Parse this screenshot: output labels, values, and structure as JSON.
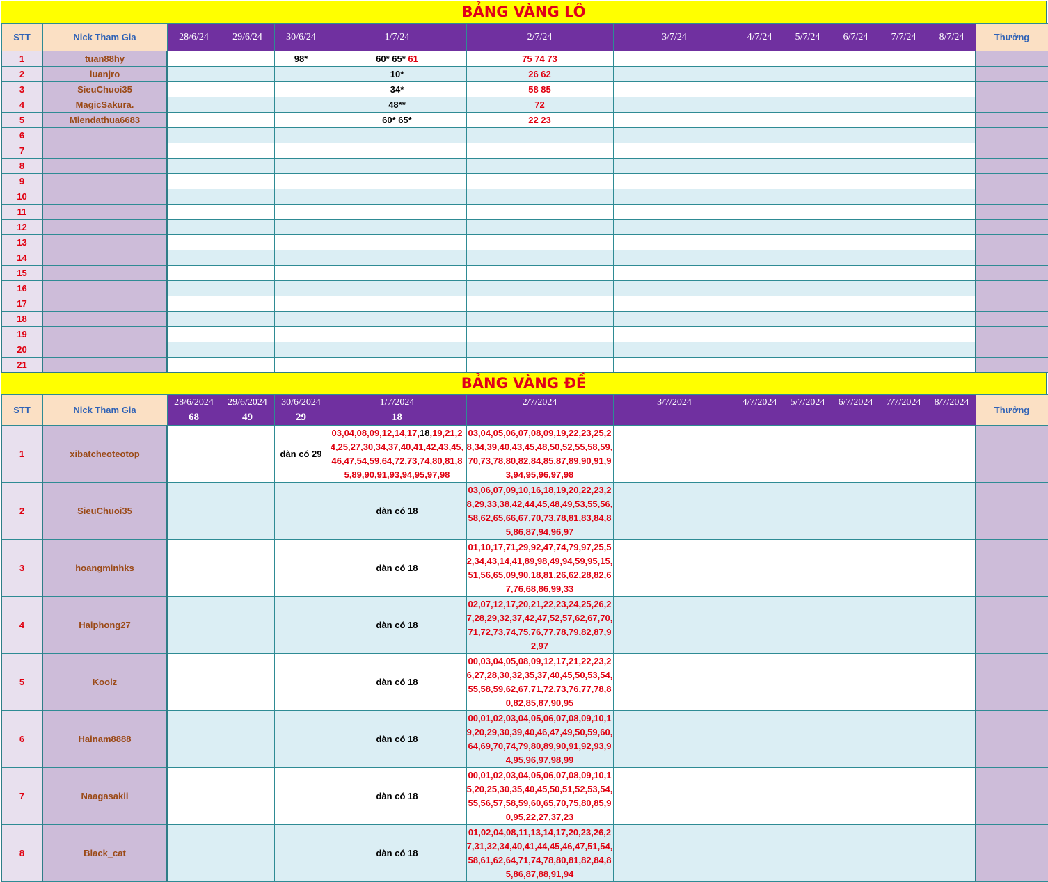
{
  "lo": {
    "title": "BẢNG VÀNG LÔ",
    "headers": {
      "stt": "STT",
      "nick": "Nick Tham Gia",
      "bonus": "Thưởng",
      "dates": [
        "28/6/24",
        "29/6/24",
        "30/6/24",
        "1/7/24",
        "2/7/24",
        "3/7/24",
        "4/7/24",
        "5/7/24",
        "6/7/24",
        "7/7/24",
        "8/7/24"
      ]
    },
    "rows": [
      {
        "stt": "1",
        "nick": "tuan88hy",
        "d30_6": "98*",
        "d1_7": "60*  65*",
        "d1_7_red": " 61",
        "d2_7": "75 74 73"
      },
      {
        "stt": "2",
        "nick": "luanjro",
        "d30_6": "",
        "d1_7": "10*",
        "d1_7_red": "",
        "d2_7": "26 62"
      },
      {
        "stt": "3",
        "nick": "SieuChuoi35",
        "d30_6": "",
        "d1_7": "34*",
        "d1_7_red": "",
        "d2_7": "58 85"
      },
      {
        "stt": "4",
        "nick": "MagicSakura.",
        "d30_6": "",
        "d1_7": "48**",
        "d1_7_red": "",
        "d2_7": "72"
      },
      {
        "stt": "5",
        "nick": "Miendathua6683",
        "d30_6": "",
        "d1_7": "60*  65*",
        "d1_7_red": "",
        "d2_7": "22 23"
      },
      {
        "stt": "6",
        "nick": ""
      },
      {
        "stt": "7",
        "nick": ""
      },
      {
        "stt": "8",
        "nick": ""
      },
      {
        "stt": "9",
        "nick": ""
      },
      {
        "stt": "10",
        "nick": ""
      },
      {
        "stt": "11",
        "nick": ""
      },
      {
        "stt": "12",
        "nick": ""
      },
      {
        "stt": "13",
        "nick": ""
      },
      {
        "stt": "14",
        "nick": ""
      },
      {
        "stt": "15",
        "nick": ""
      },
      {
        "stt": "16",
        "nick": ""
      },
      {
        "stt": "17",
        "nick": ""
      },
      {
        "stt": "18",
        "nick": ""
      },
      {
        "stt": "19",
        "nick": ""
      },
      {
        "stt": "20",
        "nick": ""
      },
      {
        "stt": "21",
        "nick": ""
      }
    ]
  },
  "de": {
    "title": "BẢNG VÀNG ĐỀ",
    "headers": {
      "stt": "STT",
      "nick": "Nick Tham Gia",
      "bonus": "Thưởng",
      "dates": [
        "28/6/2024",
        "29/6/2024",
        "30/6/2024",
        "1/7/2024",
        "2/7/2024",
        "3/7/2024",
        "4/7/2024",
        "5/7/2024",
        "6/7/2024",
        "7/7/2024",
        "8/7/2024"
      ],
      "results": [
        "68",
        "49",
        "29",
        "18",
        "",
        "",
        "",
        "",
        "",
        "",
        ""
      ]
    },
    "rows": [
      {
        "stt": "1",
        "nick": "xibatcheoteotop",
        "d30_6": "dàn có 29",
        "d1_7_a": "03,04,08,09,12,14,17,",
        "d1_7_b": "18",
        "d1_7_c": ",19,21,24,25,27,30,34,37,40,41,42,43,45,46,47,54,59,64,72,73,74,80,81,85,89,90,91,93,94,95,97,98",
        "d2_7": "03,04,05,06,07,08,09,19,22,23,25,28,34,39,40,43,45,48,50,52,55,58,59,70,73,78,80,82,84,85,87,89,90,91,93,94,95,96,97,98"
      },
      {
        "stt": "2",
        "nick": "SieuChuoi35",
        "d1_7": "dàn có 18",
        "d2_7": "03,06,07,09,10,16,18,19,20,22,23,28,29,33,38,42,44,45,48,49,53,55,56,58,62,65,66,67,70,73,78,81,83,84,85,86,87,94,96,97"
      },
      {
        "stt": "3",
        "nick": "hoangminhks",
        "d1_7": "dàn có 18",
        "d2_7": "01,10,17,71,29,92,47,74,79,97,25,52,34,43,14,41,89,98,49,94,59,95,15,51,56,65,09,90,18,81,26,62,28,82,67,76,68,86,99,33"
      },
      {
        "stt": "4",
        "nick": "Haiphong27",
        "d1_7": "dàn có 18",
        "d2_7": "02,07,12,17,20,21,22,23,24,25,26,27,28,29,32,37,42,47,52,57,62,67,70,71,72,73,74,75,76,77,78,79,82,87,92,97"
      },
      {
        "stt": "5",
        "nick": "Koolz",
        "d1_7": "dàn có 18",
        "d2_7": "00,03,04,05,08,09,12,17,21,22,23,26,27,28,30,32,35,37,40,45,50,53,54,55,58,59,62,67,71,72,73,76,77,78,80,82,85,87,90,95"
      },
      {
        "stt": "6",
        "nick": "Hainam8888",
        "d1_7": "dàn có 18",
        "d2_7": "00,01,02,03,04,05,06,07,08,09,10,19,20,29,30,39,40,46,47,49,50,59,60,64,69,70,74,79,80,89,90,91,92,93,94,95,96,97,98,99"
      },
      {
        "stt": "7",
        "nick": "Naagasakii",
        "d1_7": "dàn có 18",
        "d2_7": "00,01,02,03,04,05,06,07,08,09,10,15,20,25,30,35,40,45,50,51,52,53,54,55,56,57,58,59,60,65,70,75,80,85,90,95,22,27,37,23"
      },
      {
        "stt": "8",
        "nick": "Black_cat",
        "d1_7": "dàn có 18",
        "d2_7": "01,02,04,08,11,13,14,17,20,23,26,27,31,32,34,40,41,44,45,46,47,51,54,58,61,62,64,71,74,78,80,81,82,84,85,86,87,88,91,94"
      }
    ]
  }
}
